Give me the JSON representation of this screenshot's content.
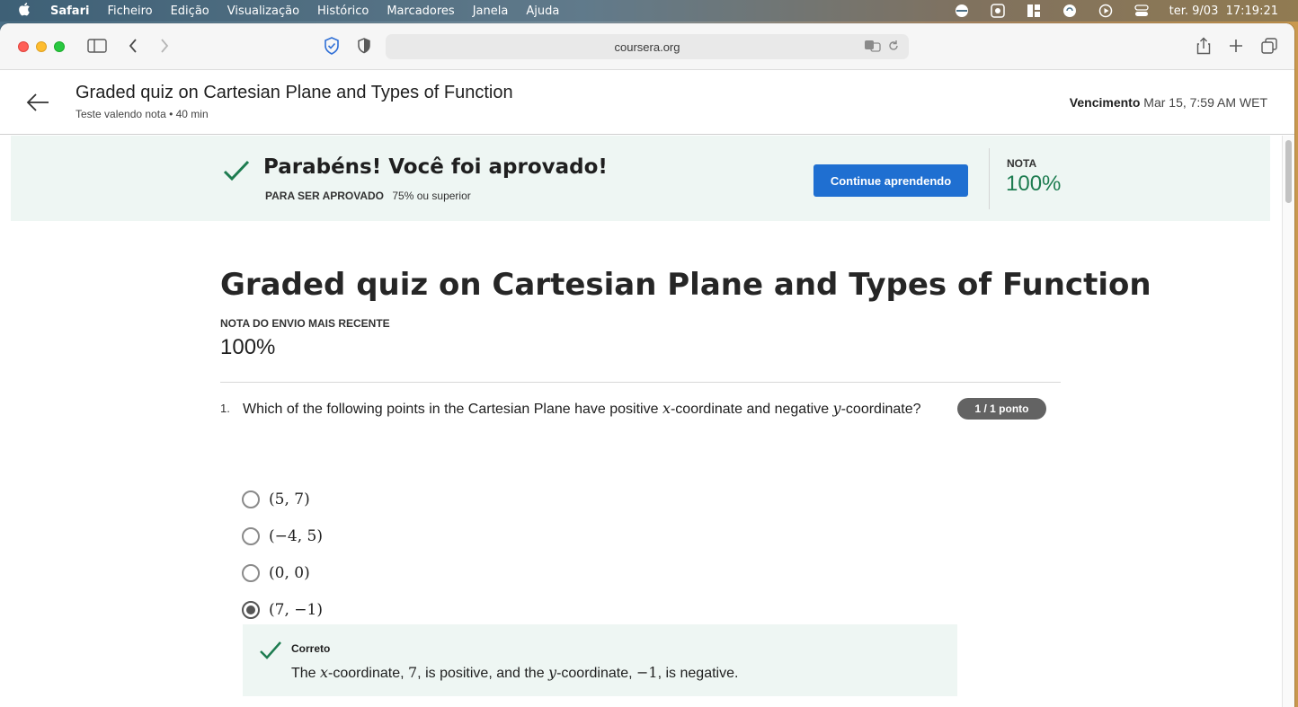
{
  "menubar": {
    "app": "Safari",
    "items": [
      "Ficheiro",
      "Edição",
      "Visualização",
      "Histórico",
      "Marcadores",
      "Janela",
      "Ajuda"
    ],
    "clock": "ter. 9/03  17:19:21"
  },
  "browser": {
    "url": "coursera.org"
  },
  "header": {
    "title": "Graded quiz on Cartesian Plane and Types of Function",
    "subtitle": "Teste valendo nota • 40 min",
    "due_label": "Vencimento",
    "due_value": "Mar 15, 7:59 AM WET"
  },
  "banner": {
    "title": "Parabéns! Você foi aprovado!",
    "pass_label": "PARA SER APROVADO",
    "pass_value": "75% ou superior",
    "continue_button": "Continue aprendendo",
    "grade_label": "NOTA",
    "grade_value": "100%",
    "accent_color": "#1d7c50"
  },
  "quiz": {
    "title": "Graded quiz on Cartesian Plane and Types of Function",
    "latest_label": "NOTA DO ENVIO MAIS RECENTE",
    "latest_value": "100%",
    "question": {
      "number": "1.",
      "text_before": "Which of the following points in the Cartesian Plane have positive ",
      "var_x": "x",
      "text_middle": "-coordinate and negative ",
      "var_y": "y",
      "text_after": "-coordinate?",
      "points": "1 / 1 ponto",
      "options": [
        {
          "label": "(5, 7)",
          "selected": false
        },
        {
          "label": "(−4, 5)",
          "selected": false
        },
        {
          "label": "(0, 0)",
          "selected": false
        },
        {
          "label": "(7, −1)",
          "selected": true
        }
      ],
      "feedback": {
        "title": "Correto",
        "p1": "The ",
        "var_x": "x",
        "p2": "-coordinate, ",
        "val_x": "7",
        "p3": ", is positive, and the ",
        "var_y": "y",
        "p4": "-coordinate, ",
        "val_y": "−1",
        "p5": ", is negative."
      }
    }
  }
}
